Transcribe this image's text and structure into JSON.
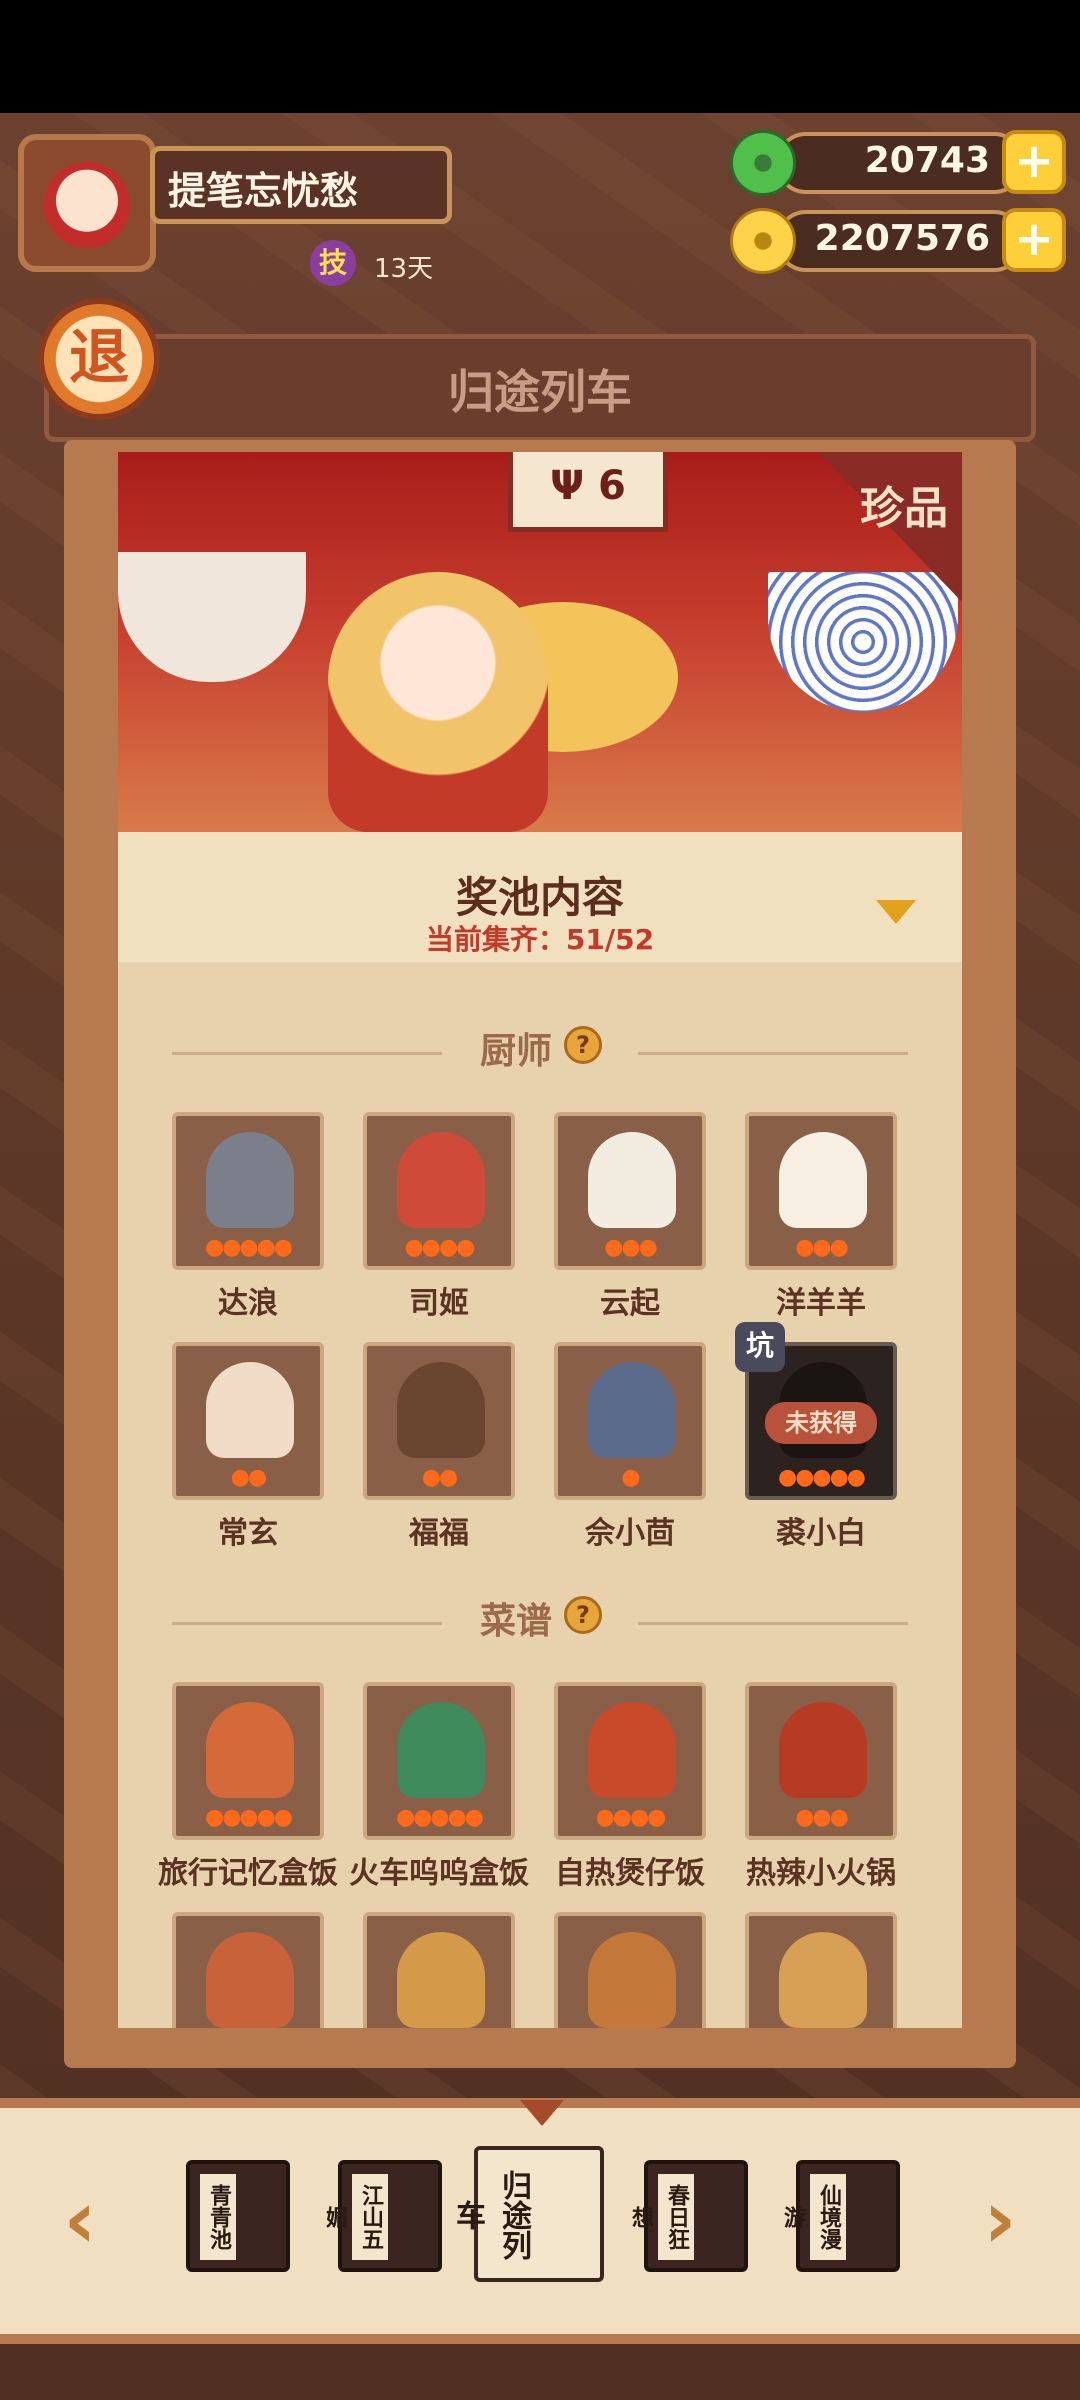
{
  "player": {
    "name": "提笔忘忧愁",
    "skill_badge": "技",
    "days": "13天"
  },
  "currencies": [
    {
      "name": "jade",
      "value": "20743"
    },
    {
      "name": "coin",
      "value": "2207576"
    }
  ],
  "header": {
    "back_label": "退",
    "title": "归途列车"
  },
  "banner": {
    "sign_text": "6",
    "rarity_tag": "珍品"
  },
  "pool": {
    "title": "奖池内容",
    "progress": "当前集齐：51/52"
  },
  "sections": {
    "chefs": {
      "title": "厨师",
      "help": "?",
      "items": [
        {
          "name": "达浪",
          "flames": 5,
          "art_color": "#7b7f8c",
          "obtained": true
        },
        {
          "name": "司姬",
          "flames": 4,
          "art_color": "#d04a3a",
          "obtained": true
        },
        {
          "name": "云起",
          "flames": 3,
          "art_color": "#f2ece0",
          "obtained": true
        },
        {
          "name": "洋羊羊",
          "flames": 3,
          "art_color": "#f7efe2",
          "obtained": true
        },
        {
          "name": "常玄",
          "flames": 2,
          "art_color": "#f0dcc6",
          "obtained": true
        },
        {
          "name": "福福",
          "flames": 2,
          "art_color": "#6a4630",
          "obtained": true
        },
        {
          "name": "佘小茴",
          "flames": 1,
          "art_color": "#5a6a8a",
          "obtained": true
        },
        {
          "name": "裘小白",
          "flames": 5,
          "art_color": "#1a1412",
          "obtained": false,
          "badge": "坑",
          "status": "未获得"
        }
      ]
    },
    "recipes": {
      "title": "菜谱",
      "help": "?",
      "items": [
        {
          "name": "旅行记忆盒饭",
          "flames": 5,
          "art_color": "#d46a3a"
        },
        {
          "name": "火车呜呜盒饭",
          "flames": 5,
          "art_color": "#3f8a5a"
        },
        {
          "name": "自热煲仔饭",
          "flames": 4,
          "art_color": "#c84a2a"
        },
        {
          "name": "热辣小火锅",
          "flames": 3,
          "art_color": "#b73a22"
        },
        {
          "name": "",
          "flames": 0,
          "art_color": "#c8623a"
        },
        {
          "name": "",
          "flames": 0,
          "art_color": "#d49a4a"
        },
        {
          "name": "",
          "flames": 0,
          "art_color": "#c4783a"
        },
        {
          "name": "",
          "flames": 0,
          "art_color": "#d8a054"
        }
      ]
    }
  },
  "themes": [
    {
      "label": "青青池",
      "active": false
    },
    {
      "label": "江山五媚",
      "active": false
    },
    {
      "label": "归途列车",
      "active": true
    },
    {
      "label": "春日狂想",
      "active": false
    },
    {
      "label": "仙境漫游",
      "active": false
    }
  ],
  "nav": {
    "prev": "‹",
    "next": "›"
  },
  "colors": {
    "accent": "#c33a2a",
    "panel": "#e8d2ad",
    "frame": "#b77a4e",
    "gold": "#ffcf3a"
  }
}
